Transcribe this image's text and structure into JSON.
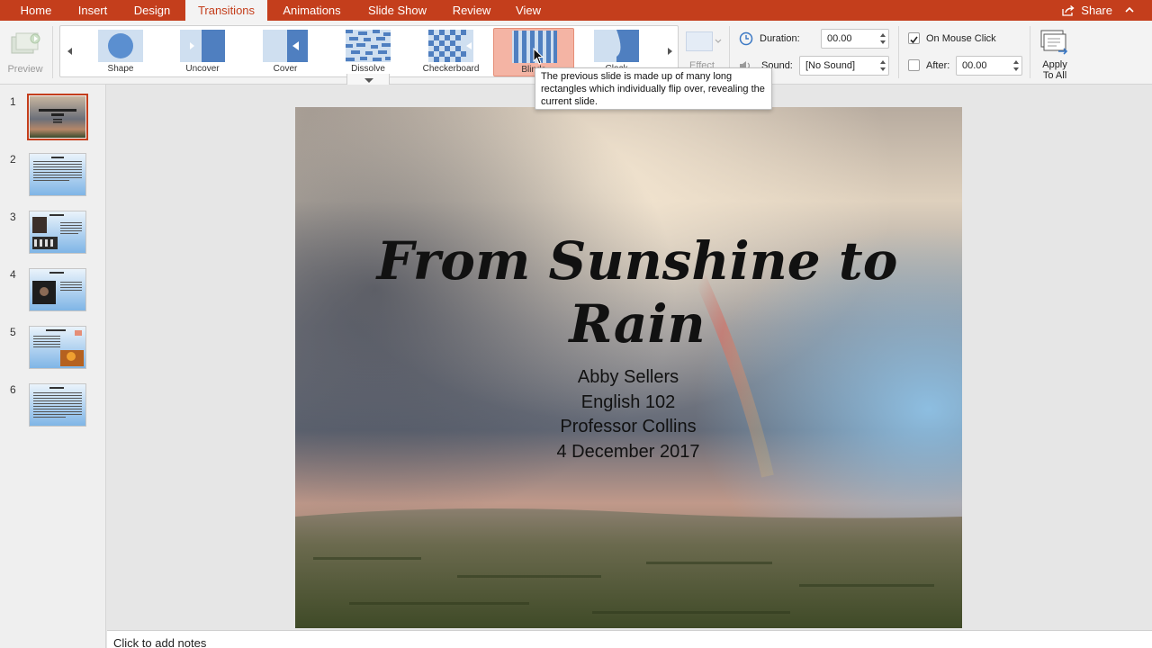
{
  "tabs": [
    {
      "label": "Home"
    },
    {
      "label": "Insert"
    },
    {
      "label": "Design"
    },
    {
      "label": "Transitions"
    },
    {
      "label": "Animations"
    },
    {
      "label": "Slide Show"
    },
    {
      "label": "Review"
    },
    {
      "label": "View"
    }
  ],
  "active_tab": "Transitions",
  "share_label": "Share",
  "ribbon": {
    "preview_label": "Preview",
    "gallery": [
      {
        "label": "Shape",
        "icon": "circle-shape-icon"
      },
      {
        "label": "Uncover",
        "icon": "uncover-icon"
      },
      {
        "label": "Cover",
        "icon": "cover-icon"
      },
      {
        "label": "Dissolve",
        "icon": "dissolve-icon"
      },
      {
        "label": "Checkerboard",
        "icon": "checkerboard-icon"
      },
      {
        "label": "Blinds",
        "icon": "blinds-icon",
        "selected": true
      },
      {
        "label": "Clock",
        "icon": "clock-wipe-icon"
      }
    ],
    "effect_label": "Effect",
    "duration_label": "Duration:",
    "duration_value": "00.00",
    "sound_label": "Sound:",
    "sound_value": "[No Sound]",
    "on_mouse_click_label": "On Mouse Click",
    "on_mouse_click_checked": true,
    "after_label": "After:",
    "after_checked": false,
    "after_value": "00.00",
    "apply_line1": "Apply",
    "apply_line2": "To All"
  },
  "tooltip": {
    "text": "The previous slide is made up of many long rectangles which individually flip over, revealing the current slide."
  },
  "slides": [
    {
      "number": "1"
    },
    {
      "number": "2"
    },
    {
      "number": "3"
    },
    {
      "number": "4"
    },
    {
      "number": "5"
    },
    {
      "number": "6"
    }
  ],
  "current_slide": {
    "title_line1": "From Sunshine to",
    "title_line2": "Rain",
    "subtitle": [
      "Abby Sellers",
      "English 102",
      "Professor Collins",
      "4 December 2017"
    ]
  },
  "notes_placeholder": "Click to add notes",
  "colors": {
    "accent": "#c43e1c",
    "selected_transition": "#f4b4a4"
  }
}
